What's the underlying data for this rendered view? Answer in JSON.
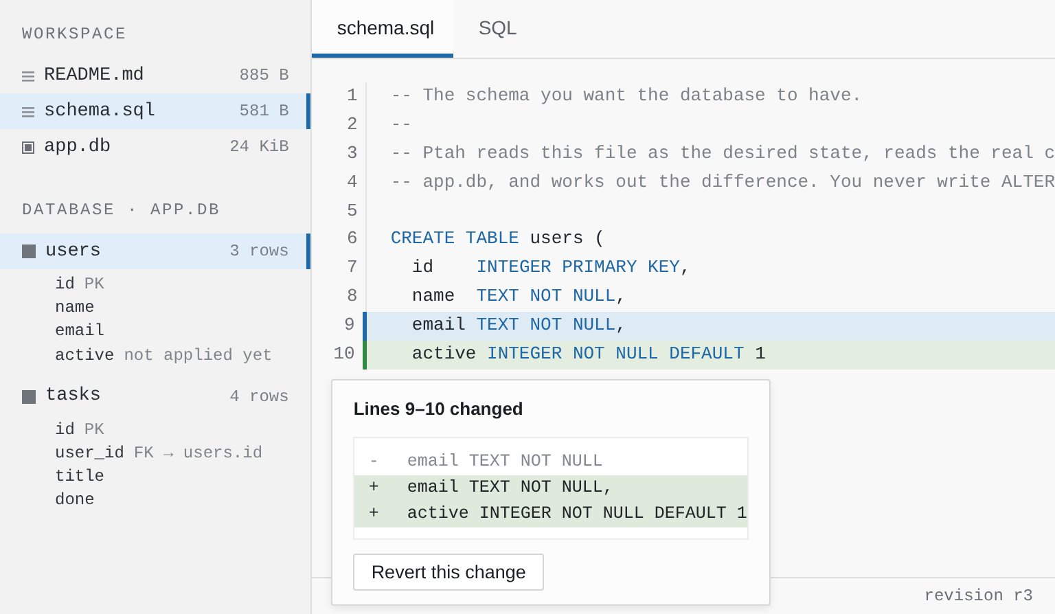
{
  "sidebar": {
    "workspace": {
      "heading": "WORKSPACE",
      "files": [
        {
          "kind": "text",
          "name": "README.md",
          "size": "885 B",
          "selected": false
        },
        {
          "kind": "text",
          "name": "schema.sql",
          "size": "581 B",
          "selected": true
        },
        {
          "kind": "database",
          "name": "app.db",
          "size": "24 KiB",
          "selected": false
        }
      ]
    },
    "database": {
      "heading": "DATABASE · APP.DB",
      "tables": [
        {
          "name": "users",
          "rows": "3 rows",
          "selected": true,
          "columns": [
            {
              "name": "id",
              "note": "PK"
            },
            {
              "name": "name"
            },
            {
              "name": "email"
            },
            {
              "name": "active",
              "note": "not applied yet"
            }
          ]
        },
        {
          "name": "tasks",
          "rows": "4 rows",
          "selected": false,
          "columns": [
            {
              "name": "id",
              "note": "PK"
            },
            {
              "name": "user_id",
              "note": "FK → users.id"
            },
            {
              "name": "title"
            },
            {
              "name": "done"
            }
          ]
        }
      ]
    }
  },
  "tabs": [
    {
      "label": "schema.sql",
      "selected": true
    },
    {
      "label": "SQL",
      "selected": false
    }
  ],
  "editor": {
    "lines": [
      {
        "number": "1",
        "kind": "plain",
        "tokens": [
          {
            "kind": "comment",
            "text": "-- The schema you want the database to have."
          }
        ]
      },
      {
        "number": "2",
        "kind": "plain",
        "tokens": [
          {
            "kind": "comment",
            "text": "--"
          }
        ]
      },
      {
        "number": "3",
        "kind": "plain",
        "tokens": [
          {
            "kind": "comment",
            "text": "-- Ptah reads this file as the desired state, reads the real c"
          }
        ]
      },
      {
        "number": "4",
        "kind": "plain",
        "tokens": [
          {
            "kind": "comment",
            "text": "-- app.db, and works out the difference. You never write ALTER"
          }
        ]
      },
      {
        "number": "5",
        "kind": "plain"
      },
      {
        "number": "6",
        "kind": "plain",
        "tokens": [
          {
            "kind": "keyword",
            "text": "CREATE TABLE"
          },
          {
            "kind": "ident",
            "text": " users ("
          }
        ]
      },
      {
        "number": "7",
        "kind": "plain",
        "tokens": [
          {
            "kind": "ident",
            "text": "  id    "
          },
          {
            "kind": "keyword",
            "text": "INTEGER PRIMARY KEY"
          },
          {
            "kind": "ident",
            "text": ","
          }
        ]
      },
      {
        "number": "8",
        "kind": "plain",
        "tokens": [
          {
            "kind": "ident",
            "text": "  name  "
          },
          {
            "kind": "keyword",
            "text": "TEXT NOT NULL"
          },
          {
            "kind": "ident",
            "text": ","
          }
        ]
      },
      {
        "number": "9",
        "kind": "modified",
        "tokens": [
          {
            "kind": "ident",
            "text": "  email "
          },
          {
            "kind": "keyword",
            "text": "TEXT NOT NULL"
          },
          {
            "kind": "ident",
            "text": ","
          }
        ]
      },
      {
        "number": "10",
        "kind": "added",
        "tokens": [
          {
            "kind": "ident",
            "text": "  active "
          },
          {
            "kind": "keyword",
            "text": "INTEGER NOT NULL DEFAULT"
          },
          {
            "kind": "ident",
            "text": " 1"
          }
        ]
      }
    ]
  },
  "popover": {
    "title": "Lines 9–10 changed",
    "diff": [
      {
        "kind": "removed",
        "sign": "-",
        "text": "email TEXT NOT NULL"
      },
      {
        "kind": "added",
        "sign": "+",
        "text": "email TEXT NOT NULL,"
      },
      {
        "kind": "added",
        "sign": "+",
        "text": "active INTEGER NOT NULL DEFAULT 1"
      }
    ],
    "button": "Revert this change"
  },
  "status_bar": {
    "revision": "revision r3"
  }
}
